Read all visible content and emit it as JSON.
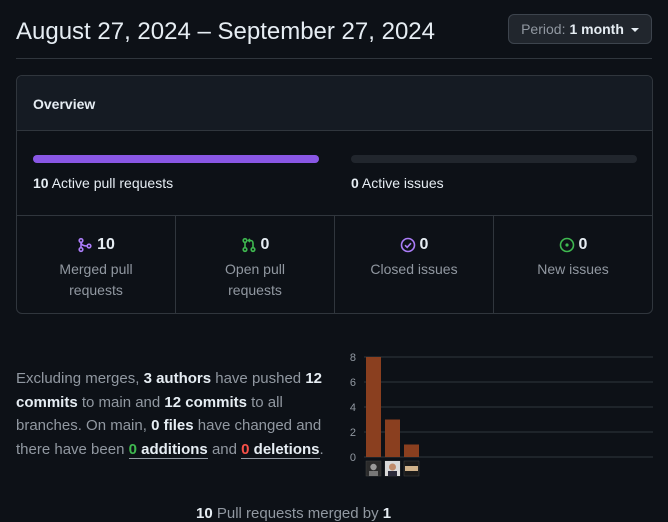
{
  "header": {
    "title": "August 27, 2024 – September 27, 2024",
    "period_label": "Period:",
    "period_value": "1 month"
  },
  "overview": {
    "heading": "Overview",
    "active_prs": {
      "count": "10",
      "label": "Active pull requests",
      "fill_fraction": 1.0,
      "color": "#8957e5"
    },
    "active_issues": {
      "count": "0",
      "label": "Active issues",
      "fill_fraction": 0.0
    },
    "stats": [
      {
        "icon": "merged-pr-icon",
        "value": "10",
        "label": "Merged pull requests",
        "color": "#ab7df8"
      },
      {
        "icon": "open-pr-icon",
        "value": "0",
        "label": "Open pull requests",
        "color": "#3fb950"
      },
      {
        "icon": "closed-issue-icon",
        "value": "0",
        "label": "Closed issues",
        "color": "#ab7df8"
      },
      {
        "icon": "open-issue-icon",
        "value": "0",
        "label": "New issues",
        "color": "#3fb950"
      }
    ]
  },
  "summary": {
    "t1": "Excluding merges, ",
    "authors": "3 authors",
    "t2": " have pushed ",
    "commits1": "12 commits",
    "t3": " to main and ",
    "commits2": "12 commits",
    "t4": " to all branches. On main, ",
    "files": "0 files",
    "t5": " have changed and there have been ",
    "additions_num": "0",
    "additions_word": " additions",
    "t6": " and ",
    "deletions_num": "0",
    "deletions_word": " deletions",
    "t7": "."
  },
  "chart_data": {
    "type": "bar",
    "categories": [
      "author-1",
      "author-2",
      "author-3"
    ],
    "values": [
      8,
      3,
      1
    ],
    "ylim": [
      0,
      8
    ],
    "yticks": [
      "0",
      "2",
      "4",
      "6",
      "8"
    ],
    "bar_color": "#8a3f1f",
    "grid": true
  },
  "footer": {
    "text_start": "10",
    "text_mid": " Pull requests merged by ",
    "text_end": "1"
  }
}
